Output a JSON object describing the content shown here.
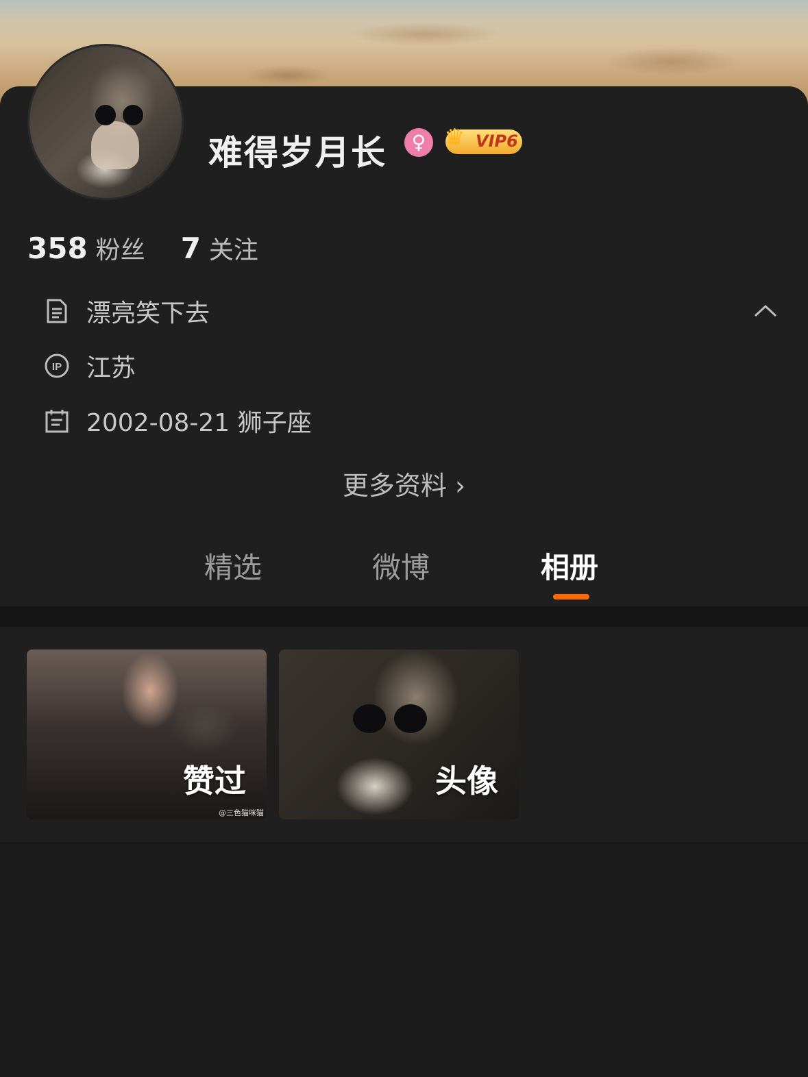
{
  "profile": {
    "name": "难得岁月长",
    "gender_symbol": "♀",
    "vip_label": "VIP6",
    "fans_count": "358",
    "fans_label": "粉丝",
    "following_count": "7",
    "following_label": "关注"
  },
  "info": {
    "bio": "漂亮笑下去",
    "ip_location": "江苏",
    "birthday": "2002-08-21 狮子座",
    "more_label": "更多资料 ›"
  },
  "tabs": [
    {
      "label": "精选"
    },
    {
      "label": "微博"
    },
    {
      "label": "相册",
      "active": true
    }
  ],
  "album": [
    {
      "label": "赞过",
      "watermark": "@三色猫咪猫"
    },
    {
      "label": "头像"
    }
  ],
  "colors": {
    "accent": "#ff6a00",
    "background": "#1a1a1a",
    "card": "#1f1f1f",
    "gender_badge": "#f07eaa"
  },
  "icons": {
    "bio": "document-icon",
    "ip": "ip-location-icon",
    "birthday": "calendar-icon",
    "collapse": "chevron-up-icon"
  }
}
